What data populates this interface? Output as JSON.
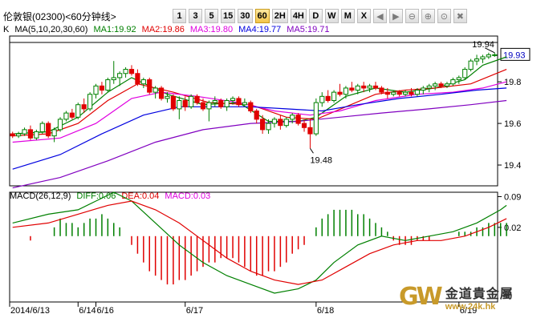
{
  "window": {
    "title": "伦敦银(02300)<60分钟线>"
  },
  "toolbar": {
    "buttons": [
      {
        "label": "1"
      },
      {
        "label": "3"
      },
      {
        "label": "5"
      },
      {
        "label": "15"
      },
      {
        "label": "30"
      },
      {
        "label": "60",
        "active": true
      },
      {
        "label": "2H"
      },
      {
        "label": "4H"
      },
      {
        "label": "D"
      },
      {
        "label": "W"
      },
      {
        "label": "M"
      },
      {
        "label": "X"
      }
    ],
    "icons": [
      "arrow-left-icon",
      "arrow-right-icon",
      "zoom-out-icon",
      "zoom-in-icon",
      "zoom-fit-icon",
      "close-icon"
    ]
  },
  "main_legend": {
    "k": "K",
    "ma": "MA(5,10,20,30,60)",
    "ma1": "MA1:19.92",
    "ma2": "MA2:19.86",
    "ma3": "MA3:19.80",
    "ma4": "MA4:19.77",
    "ma5": "MA5:19.71"
  },
  "macd_legend": {
    "macd": "MACD(26,12,9)",
    "diff": "DIFF:0.06",
    "dea": "DEA:0.04",
    "macd_value": "MACD:0.03"
  },
  "colors": {
    "up": "#008000",
    "down": "#e00000",
    "ma1": "#008000",
    "ma2": "#e00000",
    "ma3": "#e000e0",
    "ma4": "#0000e0",
    "ma5": "#8000c0",
    "diff": "#008000",
    "dea": "#e00000"
  },
  "logo": {
    "name": "金道貴金屬",
    "url": "www.24k.hk",
    "mark": "GW"
  },
  "chart_data": [
    {
      "type": "candlestick",
      "title": "伦敦银(02300)<60分钟线>",
      "y_ticks": [
        19.4,
        19.6,
        19.8
      ],
      "ylim": [
        19.3,
        20.02
      ],
      "current_price": "19.93",
      "annotations": [
        {
          "label": "19.94",
          "index": 81,
          "value": 19.94
        },
        {
          "label": "19.48",
          "index": 50,
          "value": 19.48
        }
      ],
      "x_labels": [
        {
          "label": "2014/6/13",
          "index": 0
        },
        {
          "label": "6/14",
          "index": 11
        },
        {
          "label": "6/16",
          "index": 14
        },
        {
          "label": "6/17",
          "index": 29
        },
        {
          "label": "6/18",
          "index": 51
        },
        {
          "label": "6/19",
          "index": 75
        }
      ],
      "candles": [
        [
          19.55,
          19.56,
          19.53,
          19.54
        ],
        [
          19.54,
          19.56,
          19.53,
          19.55
        ],
        [
          19.55,
          19.58,
          19.54,
          19.57
        ],
        [
          19.57,
          19.59,
          19.52,
          19.53
        ],
        [
          19.53,
          19.57,
          19.52,
          19.56
        ],
        [
          19.56,
          19.61,
          19.55,
          19.6
        ],
        [
          19.6,
          19.61,
          19.53,
          19.54
        ],
        [
          19.54,
          19.58,
          19.51,
          19.57
        ],
        [
          19.57,
          19.63,
          19.56,
          19.62
        ],
        [
          19.62,
          19.66,
          19.61,
          19.65
        ],
        [
          19.65,
          19.67,
          19.62,
          19.63
        ],
        [
          19.63,
          19.7,
          19.62,
          19.69
        ],
        [
          19.69,
          19.72,
          19.65,
          19.67
        ],
        [
          19.67,
          19.75,
          19.66,
          19.74
        ],
        [
          19.74,
          19.79,
          19.72,
          19.78
        ],
        [
          19.78,
          19.8,
          19.74,
          19.76
        ],
        [
          19.76,
          19.82,
          19.75,
          19.81
        ],
        [
          19.81,
          19.9,
          19.79,
          19.82
        ],
        [
          19.82,
          19.85,
          19.78,
          19.84
        ],
        [
          19.84,
          19.87,
          19.82,
          19.86
        ],
        [
          19.86,
          19.88,
          19.83,
          19.84
        ],
        [
          19.84,
          19.86,
          19.78,
          19.79
        ],
        [
          19.79,
          19.82,
          19.77,
          19.81
        ],
        [
          19.81,
          19.82,
          19.74,
          19.75
        ],
        [
          19.75,
          19.78,
          19.72,
          19.77
        ],
        [
          19.77,
          19.78,
          19.71,
          19.72
        ],
        [
          19.72,
          19.75,
          19.7,
          19.73
        ],
        [
          19.73,
          19.74,
          19.66,
          19.67
        ],
        [
          19.67,
          19.73,
          19.62,
          19.71
        ],
        [
          19.71,
          19.73,
          19.66,
          19.68
        ],
        [
          19.68,
          19.74,
          19.67,
          19.73
        ],
        [
          19.73,
          19.74,
          19.69,
          19.7
        ],
        [
          19.7,
          19.72,
          19.66,
          19.67
        ],
        [
          19.67,
          19.71,
          19.61,
          19.7
        ],
        [
          19.7,
          19.73,
          19.68,
          19.71
        ],
        [
          19.71,
          19.72,
          19.67,
          19.68
        ],
        [
          19.68,
          19.72,
          19.66,
          19.71
        ],
        [
          19.71,
          19.73,
          19.69,
          19.72
        ],
        [
          19.72,
          19.73,
          19.68,
          19.69
        ],
        [
          19.69,
          19.72,
          19.68,
          19.7
        ],
        [
          19.7,
          19.71,
          19.65,
          19.66
        ],
        [
          19.66,
          19.67,
          19.6,
          19.62
        ],
        [
          19.62,
          19.64,
          19.55,
          19.57
        ],
        [
          19.57,
          19.62,
          19.55,
          19.6
        ],
        [
          19.6,
          19.63,
          19.58,
          19.62
        ],
        [
          19.62,
          19.64,
          19.57,
          19.59
        ],
        [
          19.59,
          19.63,
          19.58,
          19.62
        ],
        [
          19.62,
          19.65,
          19.6,
          19.64
        ],
        [
          19.64,
          19.65,
          19.59,
          19.6
        ],
        [
          19.6,
          19.62,
          19.56,
          19.58
        ],
        [
          19.58,
          19.62,
          19.48,
          19.55
        ],
        [
          19.55,
          19.72,
          19.54,
          19.7
        ],
        [
          19.7,
          19.75,
          19.68,
          19.73
        ],
        [
          19.73,
          19.76,
          19.7,
          19.71
        ],
        [
          19.71,
          19.76,
          19.7,
          19.75
        ],
        [
          19.75,
          19.79,
          19.73,
          19.74
        ],
        [
          19.74,
          19.78,
          19.72,
          19.77
        ],
        [
          19.77,
          19.8,
          19.75,
          19.76
        ],
        [
          19.76,
          19.79,
          19.74,
          19.78
        ],
        [
          19.78,
          19.8,
          19.75,
          19.77
        ],
        [
          19.77,
          19.79,
          19.75,
          19.78
        ],
        [
          19.78,
          19.8,
          19.76,
          19.77
        ],
        [
          19.77,
          19.78,
          19.74,
          19.75
        ],
        [
          19.75,
          19.77,
          19.72,
          19.74
        ],
        [
          19.74,
          19.76,
          19.73,
          19.75
        ],
        [
          19.75,
          19.76,
          19.73,
          19.74
        ],
        [
          19.74,
          19.76,
          19.73,
          19.75
        ],
        [
          19.75,
          19.77,
          19.73,
          19.74
        ],
        [
          19.74,
          19.77,
          19.73,
          19.76
        ],
        [
          19.76,
          19.78,
          19.74,
          19.77
        ],
        [
          19.77,
          19.79,
          19.75,
          19.78
        ],
        [
          19.78,
          19.8,
          19.76,
          19.79
        ],
        [
          19.79,
          19.8,
          19.77,
          19.78
        ],
        [
          19.78,
          19.8,
          19.77,
          19.79
        ],
        [
          19.79,
          19.82,
          19.78,
          19.81
        ],
        [
          19.81,
          19.83,
          19.79,
          19.82
        ],
        [
          19.82,
          19.87,
          19.81,
          19.86
        ],
        [
          19.86,
          19.91,
          19.85,
          19.9
        ],
        [
          19.9,
          19.93,
          19.88,
          19.91
        ],
        [
          19.91,
          19.93,
          19.89,
          19.92
        ],
        [
          19.92,
          19.94,
          19.91,
          19.93
        ],
        [
          19.93,
          19.94,
          19.92,
          19.93
        ]
      ],
      "ma_series": [
        {
          "name": "MA1",
          "color": "#008000",
          "points": [
            [
              0,
              19.55
            ],
            [
              6,
              19.56
            ],
            [
              11,
              19.63
            ],
            [
              16,
              19.75
            ],
            [
              20,
              19.82
            ],
            [
              26,
              19.74
            ],
            [
              32,
              19.69
            ],
            [
              38,
              19.7
            ],
            [
              43,
              19.61
            ],
            [
              48,
              19.61
            ],
            [
              51,
              19.63
            ],
            [
              56,
              19.73
            ],
            [
              61,
              19.77
            ],
            [
              66,
              19.75
            ],
            [
              71,
              19.77
            ],
            [
              76,
              19.81
            ],
            [
              79,
              19.88
            ],
            [
              83,
              19.92
            ]
          ]
        },
        {
          "name": "MA2",
          "color": "#e00000",
          "points": [
            [
              0,
              19.54
            ],
            [
              6,
              19.55
            ],
            [
              11,
              19.6
            ],
            [
              16,
              19.71
            ],
            [
              21,
              19.79
            ],
            [
              27,
              19.75
            ],
            [
              33,
              19.7
            ],
            [
              40,
              19.69
            ],
            [
              46,
              19.63
            ],
            [
              51,
              19.62
            ],
            [
              56,
              19.68
            ],
            [
              61,
              19.74
            ],
            [
              66,
              19.76
            ],
            [
              71,
              19.77
            ],
            [
              77,
              19.79
            ],
            [
              83,
              19.86
            ]
          ]
        },
        {
          "name": "MA3",
          "color": "#e000e0",
          "points": [
            [
              0,
              19.51
            ],
            [
              8,
              19.53
            ],
            [
              14,
              19.6
            ],
            [
              20,
              19.72
            ],
            [
              25,
              19.75
            ],
            [
              31,
              19.73
            ],
            [
              38,
              19.7
            ],
            [
              44,
              19.66
            ],
            [
              50,
              19.64
            ],
            [
              55,
              19.66
            ],
            [
              61,
              19.71
            ],
            [
              68,
              19.74
            ],
            [
              74,
              19.75
            ],
            [
              79,
              19.77
            ],
            [
              83,
              19.8
            ]
          ]
        },
        {
          "name": "MA4",
          "color": "#0000e0",
          "points": [
            [
              0,
              19.38
            ],
            [
              8,
              19.45
            ],
            [
              15,
              19.55
            ],
            [
              22,
              19.64
            ],
            [
              28,
              19.68
            ],
            [
              34,
              19.68
            ],
            [
              40,
              19.68
            ],
            [
              46,
              19.67
            ],
            [
              52,
              19.66
            ],
            [
              58,
              19.69
            ],
            [
              65,
              19.72
            ],
            [
              72,
              19.74
            ],
            [
              78,
              19.76
            ],
            [
              83,
              19.77
            ]
          ]
        },
        {
          "name": "MA5",
          "color": "#8000c0",
          "points": [
            [
              0,
              19.29
            ],
            [
              8,
              19.34
            ],
            [
              16,
              19.42
            ],
            [
              24,
              19.51
            ],
            [
              32,
              19.57
            ],
            [
              40,
              19.6
            ],
            [
              48,
              19.61
            ],
            [
              55,
              19.63
            ],
            [
              62,
              19.65
            ],
            [
              70,
              19.67
            ],
            [
              77,
              19.69
            ],
            [
              83,
              19.71
            ]
          ]
        }
      ]
    },
    {
      "type": "macd",
      "y_ticks": [
        0.02,
        0.09
      ],
      "ylim": [
        -0.15,
        0.1
      ],
      "diff": [
        [
          0,
          0.03
        ],
        [
          6,
          0.05
        ],
        [
          11,
          0.06
        ],
        [
          14,
          0.08
        ],
        [
          17,
          0.1
        ],
        [
          20,
          0.08
        ],
        [
          24,
          0.03
        ],
        [
          28,
          -0.02
        ],
        [
          32,
          -0.06
        ],
        [
          36,
          -0.09
        ],
        [
          40,
          -0.11
        ],
        [
          44,
          -0.13
        ],
        [
          48,
          -0.12
        ],
        [
          51,
          -0.1
        ],
        [
          54,
          -0.06
        ],
        [
          58,
          -0.02
        ],
        [
          62,
          0.0
        ],
        [
          66,
          -0.01
        ],
        [
          70,
          0.0
        ],
        [
          74,
          0.01
        ],
        [
          78,
          0.03
        ],
        [
          82,
          0.06
        ],
        [
          83,
          0.07
        ]
      ],
      "dea": [
        [
          0,
          0.02
        ],
        [
          6,
          0.03
        ],
        [
          11,
          0.05
        ],
        [
          16,
          0.07
        ],
        [
          20,
          0.08
        ],
        [
          24,
          0.06
        ],
        [
          28,
          0.03
        ],
        [
          32,
          -0.01
        ],
        [
          36,
          -0.05
        ],
        [
          40,
          -0.08
        ],
        [
          44,
          -0.1
        ],
        [
          48,
          -0.11
        ],
        [
          52,
          -0.1
        ],
        [
          56,
          -0.07
        ],
        [
          60,
          -0.04
        ],
        [
          64,
          -0.02
        ],
        [
          68,
          -0.01
        ],
        [
          72,
          -0.01
        ],
        [
          76,
          0.0
        ],
        [
          80,
          0.02
        ],
        [
          83,
          0.04
        ]
      ],
      "macd": [
        0.0,
        0.0,
        0.0,
        -0.01,
        0.0,
        0.0,
        0.0,
        0.02,
        0.04,
        0.03,
        0.03,
        0.02,
        0.03,
        0.04,
        0.04,
        0.05,
        0.04,
        0.03,
        0.02,
        0.0,
        -0.02,
        -0.04,
        -0.06,
        -0.08,
        -0.09,
        -0.1,
        -0.11,
        -0.11,
        -0.1,
        -0.1,
        -0.09,
        -0.08,
        -0.07,
        -0.06,
        -0.06,
        -0.05,
        -0.05,
        -0.05,
        -0.06,
        -0.07,
        -0.08,
        -0.09,
        -0.09,
        -0.08,
        -0.08,
        -0.07,
        -0.06,
        -0.04,
        -0.03,
        -0.02,
        0.0,
        0.02,
        0.04,
        0.05,
        0.06,
        0.06,
        0.06,
        0.06,
        0.05,
        0.05,
        0.04,
        0.03,
        0.02,
        0.01,
        -0.01,
        -0.02,
        -0.02,
        -0.02,
        -0.01,
        -0.01,
        -0.01,
        0.0,
        0.0,
        0.0,
        0.0,
        0.01,
        0.01,
        0.01,
        0.02,
        0.02,
        0.03,
        0.03,
        0.03,
        0.03
      ]
    }
  ]
}
